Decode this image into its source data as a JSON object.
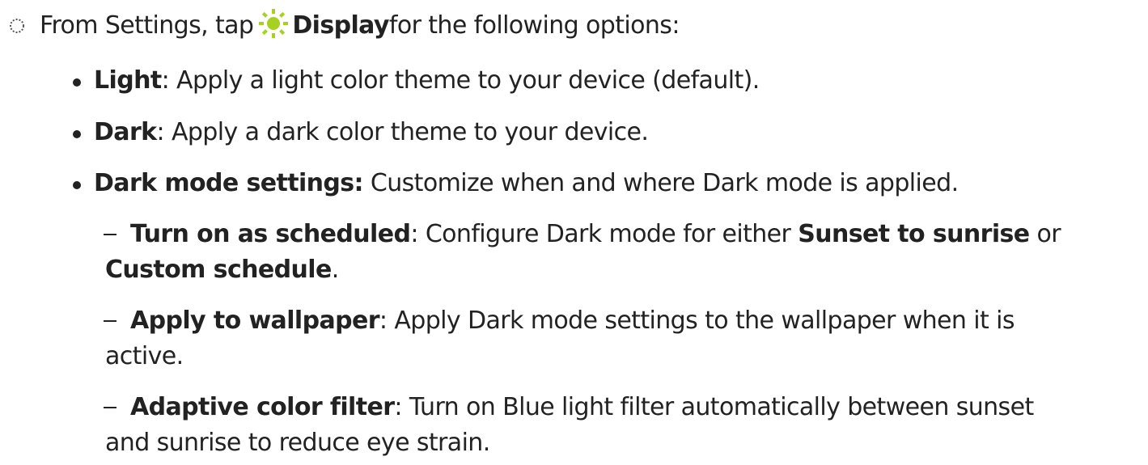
{
  "intro": {
    "icon": "step-circle-icon",
    "lead": "From Settings, tap",
    "sun_icon": "display-sun-icon",
    "sun_color": "#a6d11f",
    "link": "Display",
    "tail": " for the following options:"
  },
  "options": [
    {
      "term": "Light",
      "desc": ": Apply a light color theme to your device (default)."
    },
    {
      "term": "Dark",
      "desc": ": Apply a dark color theme to your device."
    },
    {
      "term": "Dark mode settings:",
      "desc": " Customize when and where Dark mode is applied."
    }
  ],
  "dark_mode_settings": [
    {
      "term": "Turn on as scheduled",
      "desc": ": Configure Dark mode for either ",
      "opt1": "Sunset to sunrise",
      "mid": " or",
      "opt2": "Custom schedule",
      "end": "."
    },
    {
      "term": "Apply to wallpaper",
      "desc": ": Apply Dark mode settings to the wallpaper when it is",
      "cont": "active."
    },
    {
      "term": "Adaptive color filter",
      "desc": ": Turn on Blue light filter automatically between sunset",
      "cont": "and sunrise to reduce eye strain."
    }
  ]
}
